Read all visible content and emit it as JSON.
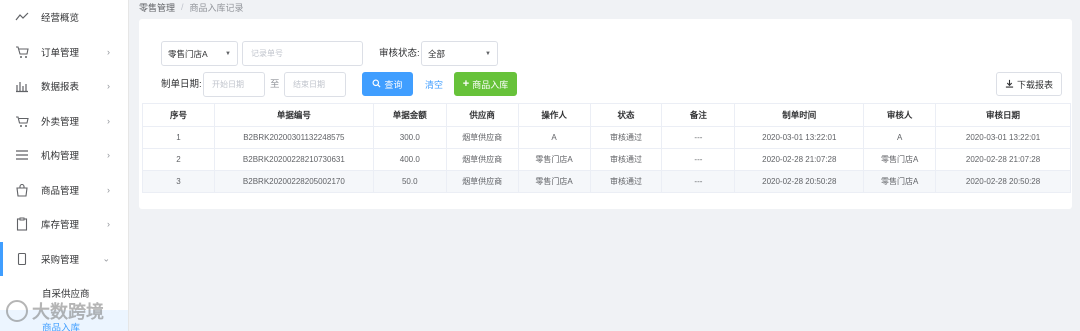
{
  "sidebar": {
    "items": [
      {
        "label": "经营概览",
        "icon": "trend-icon",
        "arrow": ""
      },
      {
        "label": "订单管理",
        "icon": "cart-icon",
        "arrow": "›"
      },
      {
        "label": "数据报表",
        "icon": "bar-chart-icon",
        "arrow": "›"
      },
      {
        "label": "外卖管理",
        "icon": "takeout-cart-icon",
        "arrow": "›"
      },
      {
        "label": "机构管理",
        "icon": "list-icon",
        "arrow": "›"
      },
      {
        "label": "商品管理",
        "icon": "bag-icon",
        "arrow": "›"
      },
      {
        "label": "库存管理",
        "icon": "clipboard-icon",
        "arrow": "›"
      },
      {
        "label": "采购管理",
        "icon": "phone-icon",
        "arrow": "⌄"
      }
    ],
    "sub_items": [
      {
        "label": "自采供应商"
      },
      {
        "label": "商品入库"
      }
    ]
  },
  "breadcrumb": {
    "parent": "零售管理",
    "separator": "/",
    "current": "商品入库记录"
  },
  "filters": {
    "store_select": "零售门店A",
    "record_no_placeholder": "记录单号",
    "status_label": "审核状态:",
    "status_select": "全部",
    "date_label": "制单日期:",
    "start_placeholder": "开始日期",
    "to_label": "至",
    "end_placeholder": "结束日期"
  },
  "actions": {
    "query": "查询",
    "clear": "清空",
    "stock_in": "商品入库",
    "download": "下载报表"
  },
  "table": {
    "headers": [
      "序号",
      "单据编号",
      "单据金额",
      "供应商",
      "操作人",
      "状态",
      "备注",
      "制单时间",
      "审核人",
      "审核日期"
    ],
    "rows": [
      [
        "1",
        "B2BRK20200301132248575",
        "300.0",
        "烟草供应商",
        "A",
        "审核通过",
        "---",
        "2020-03-01 13:22:01",
        "A",
        "2020-03-01 13:22:01"
      ],
      [
        "2",
        "B2BRK20200228210730631",
        "400.0",
        "烟草供应商",
        "零售门店A",
        "审核通过",
        "---",
        "2020-02-28 21:07:28",
        "零售门店A",
        "2020-02-28 21:07:28"
      ],
      [
        "3",
        "B2BRK20200228205002170",
        "50.0",
        "烟草供应商",
        "零售门店A",
        "审核通过",
        "---",
        "2020-02-28 20:50:28",
        "零售门店A",
        "2020-02-28 20:50:28"
      ]
    ]
  },
  "watermark": "大数跨境",
  "colors": {
    "primary": "#409eff",
    "success": "#67c23a",
    "active_bg": "#ecf5ff"
  }
}
